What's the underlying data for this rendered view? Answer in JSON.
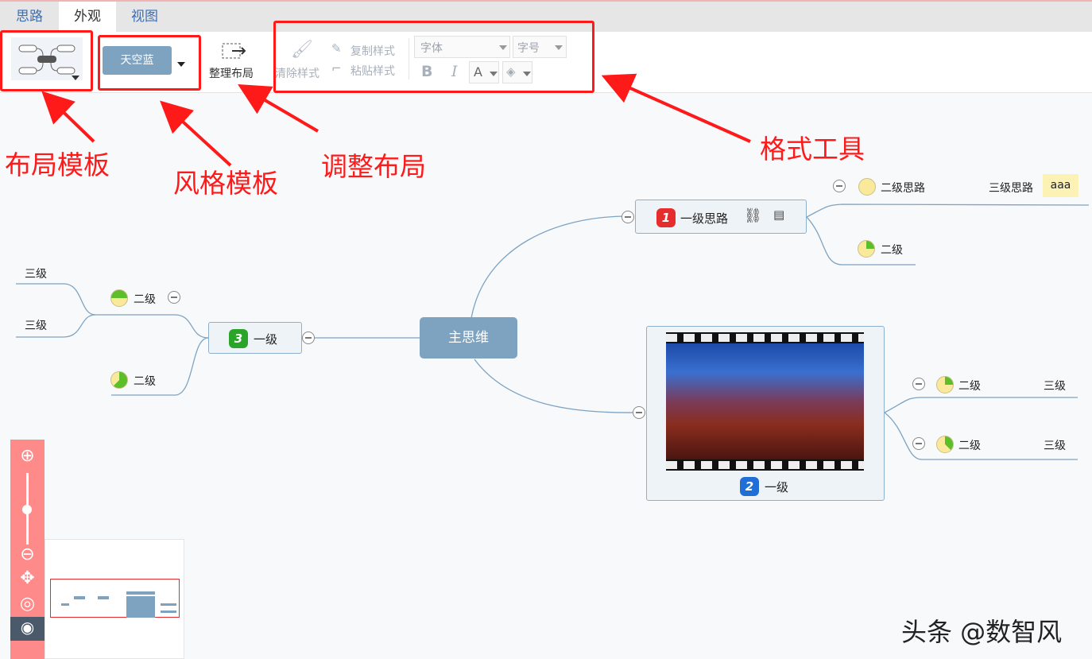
{
  "tabs": [
    {
      "label": "思路",
      "active": false
    },
    {
      "label": "外观",
      "active": true
    },
    {
      "label": "视图",
      "active": false
    }
  ],
  "toolbar": {
    "style_template": "天空蓝",
    "tidy_layout": "整理布局",
    "clear_style": "清除样式",
    "copy_style": "复制样式",
    "paste_style": "粘贴样式",
    "font_placeholder": "字体",
    "size_placeholder": "字号",
    "bold": "B",
    "italic": "I",
    "font_color": "A"
  },
  "annotations": {
    "layout_template": "布局模板",
    "style_template": "风格模板",
    "adjust_layout": "调整布局",
    "format_tools": "格式工具"
  },
  "mindmap": {
    "root": "主思维",
    "branch1": {
      "badge": "1",
      "label": "一级思路",
      "children": [
        {
          "label": "二级思路",
          "grandchild": "三级思路",
          "note": "aaa"
        },
        {
          "label": "二级"
        }
      ]
    },
    "branch2": {
      "badge": "2",
      "label": "一级",
      "children": [
        {
          "label": "二级",
          "grandchild": "三级"
        },
        {
          "label": "二级",
          "grandchild": "三级"
        }
      ]
    },
    "branch3": {
      "badge": "3",
      "label": "一级",
      "children": [
        {
          "label": "二级",
          "grandchildren": [
            "三级",
            "三级"
          ]
        },
        {
          "label": "二级"
        }
      ]
    }
  },
  "colors": {
    "accent": "#7ea3c1",
    "annotation": "#ff1a1a",
    "zoombar": "#ff8a8a",
    "badge1": "#e52d2d",
    "badge2": "#1f6fd6",
    "badge3": "#2aa52a"
  },
  "watermark": "头条 @数智风"
}
